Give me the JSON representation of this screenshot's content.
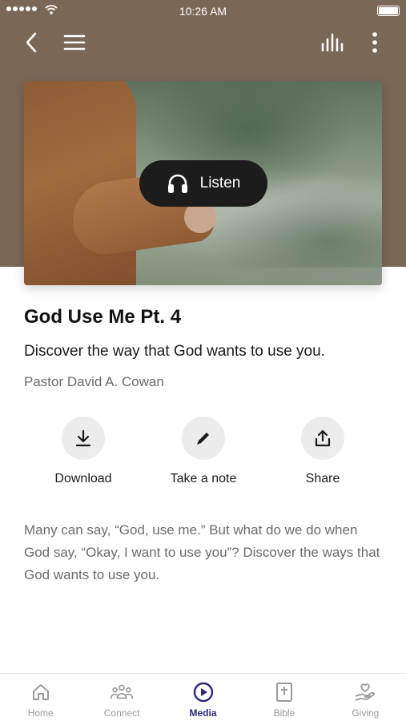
{
  "status_bar": {
    "time": "10:26 AM"
  },
  "nav": {
    "icons": [
      "back-icon",
      "menu-icon",
      "equalizer-icon",
      "more-icon"
    ]
  },
  "hero": {
    "listen_label": "Listen",
    "listen_icon": "headphones-icon"
  },
  "sermon": {
    "title": "God Use Me Pt. 4",
    "subtitle": "Discover the way that God wants to use you.",
    "speaker": "Pastor David A. Cowan",
    "description": "Many can say, “God, use me.” But what do we do when God say, “Okay, I want to use you”? Discover the ways that God wants to use you."
  },
  "actions": [
    {
      "label": "Download",
      "icon": "download-icon"
    },
    {
      "label": "Take a note",
      "icon": "pencil-icon"
    },
    {
      "label": "Share",
      "icon": "share-icon"
    }
  ],
  "tabs": [
    {
      "label": "Home",
      "icon": "home-icon",
      "active": false
    },
    {
      "label": "Connect",
      "icon": "people-icon",
      "active": false
    },
    {
      "label": "Media",
      "icon": "play-icon",
      "active": true
    },
    {
      "label": "Bible",
      "icon": "bible-icon",
      "active": false
    },
    {
      "label": "Giving",
      "icon": "giving-icon",
      "active": false
    }
  ],
  "colors": {
    "hero_background": "#7b6756",
    "active_tab": "#2a2a7a",
    "inactive_tab": "#9a9a9a"
  }
}
